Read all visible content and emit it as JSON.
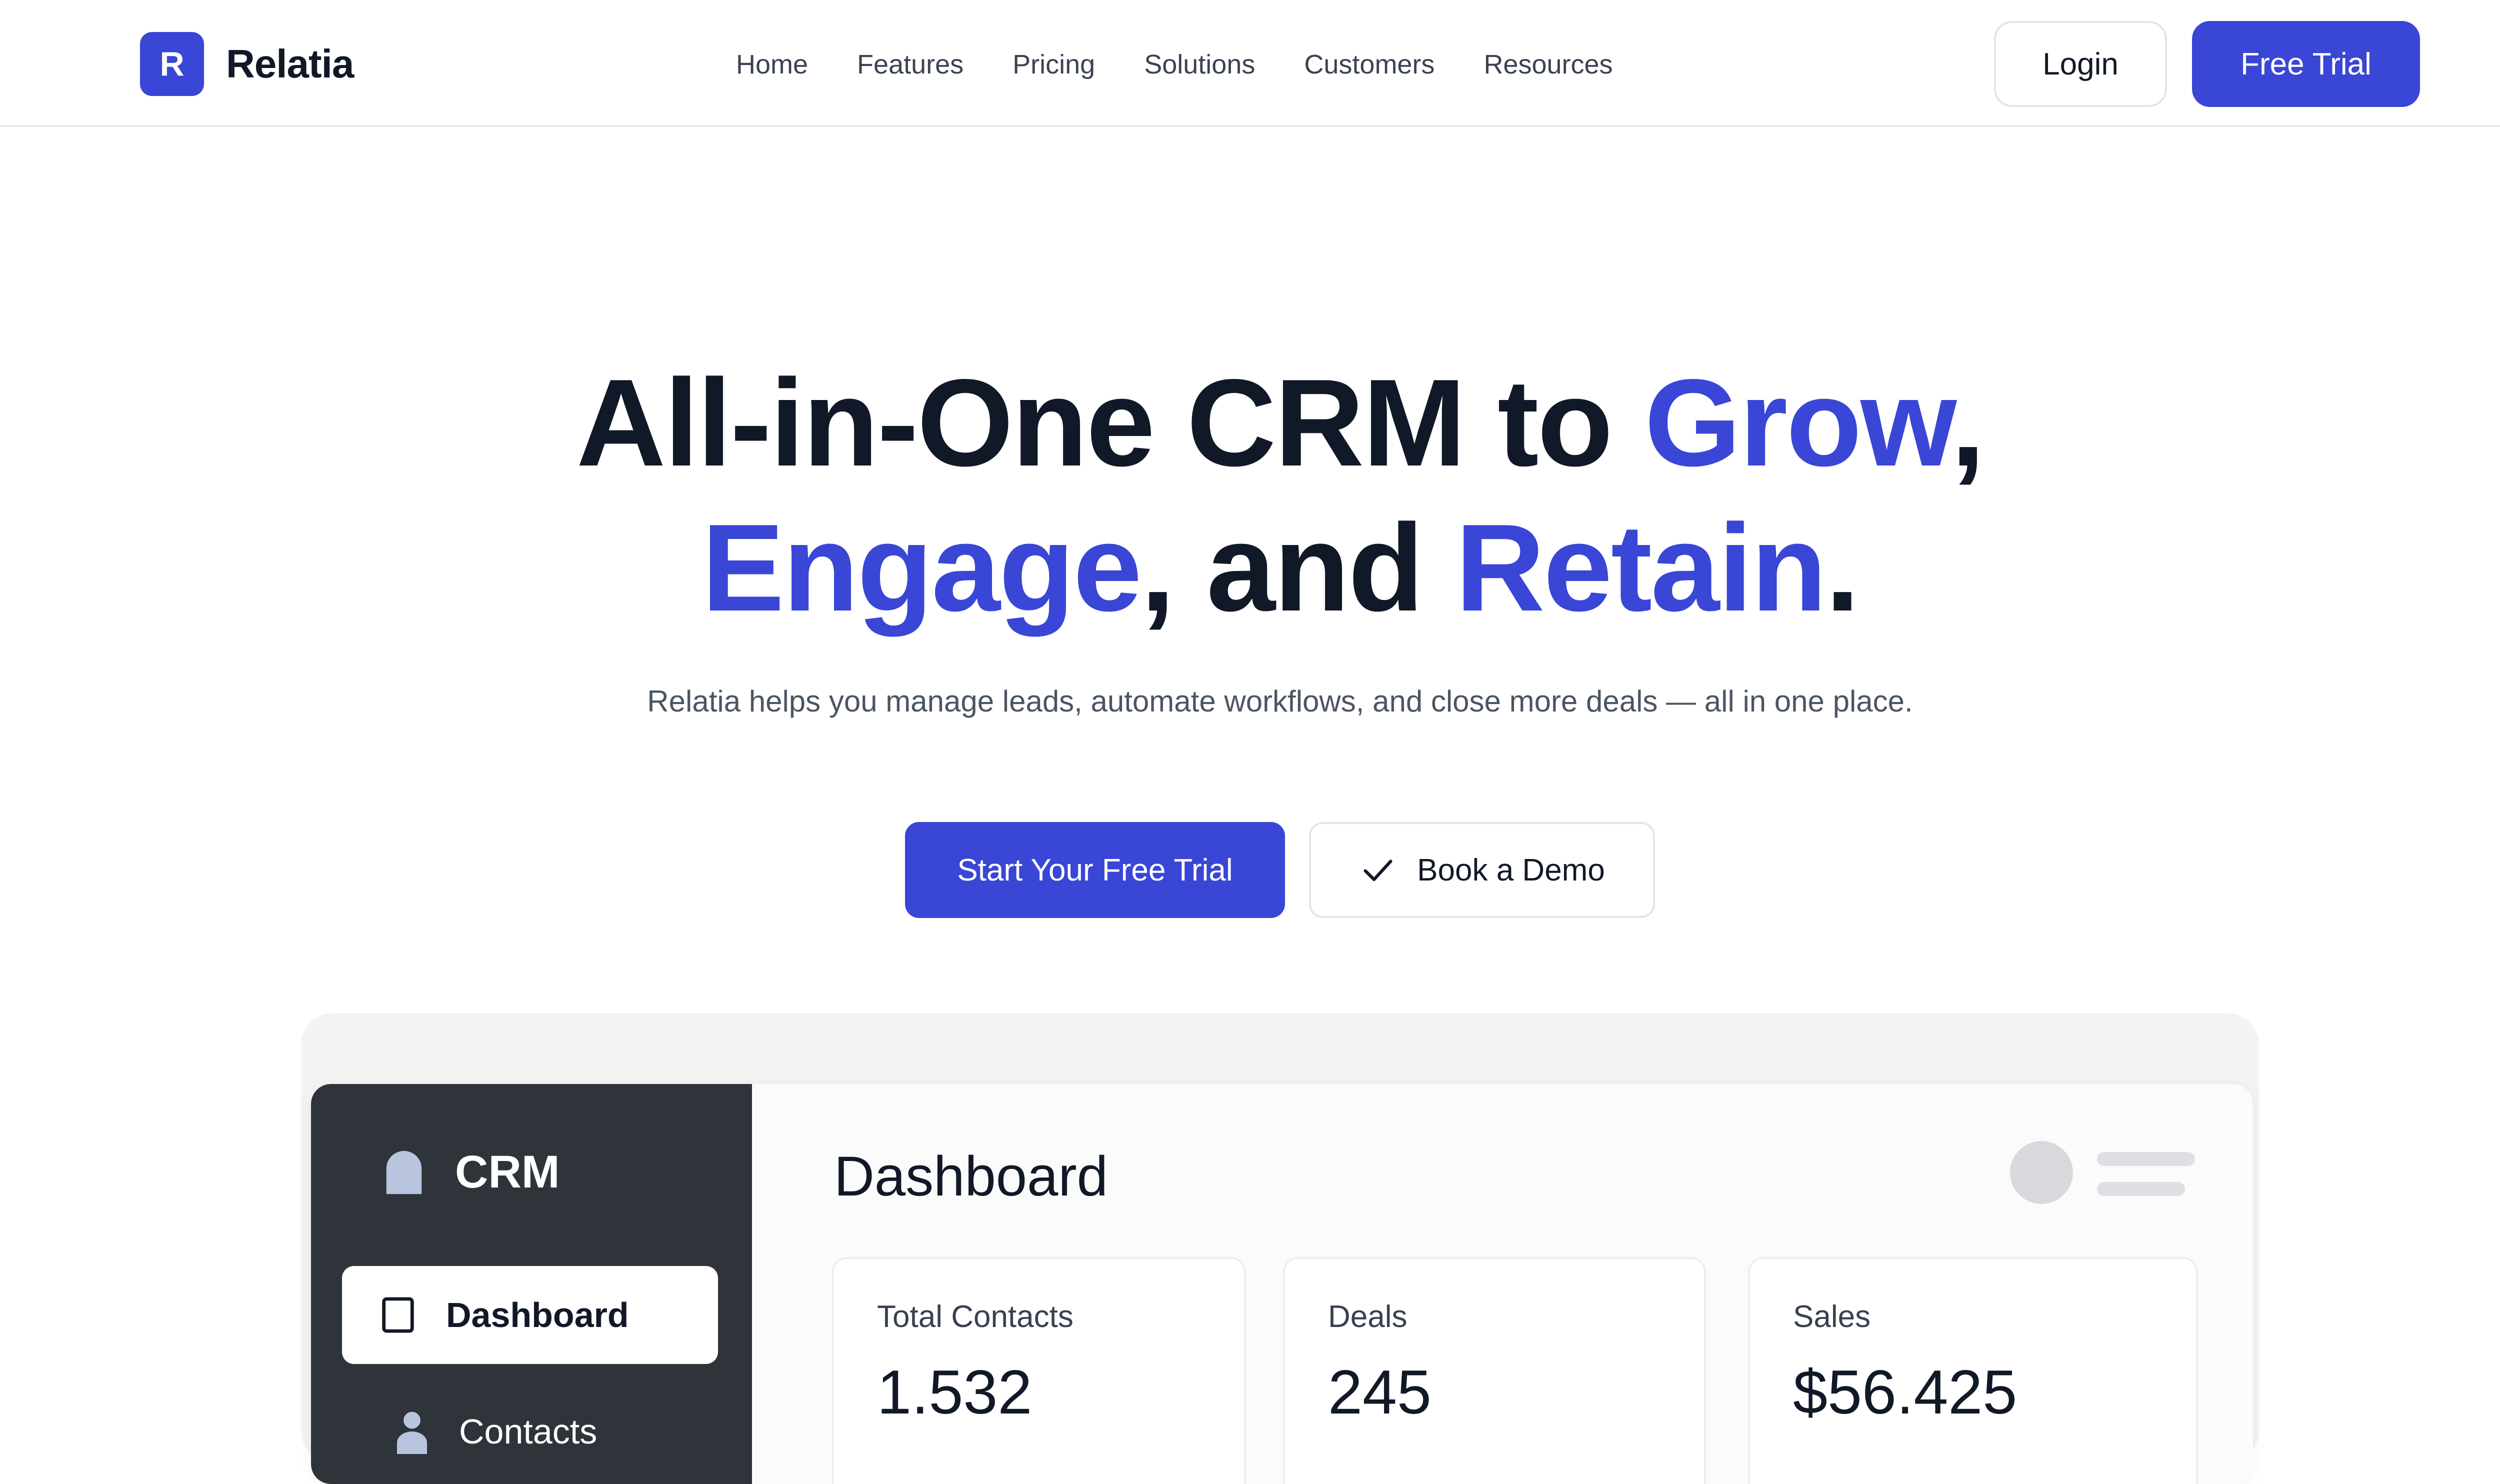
{
  "navbar": {
    "logo_letter": "R",
    "brand": "Relatia",
    "links": [
      "Home",
      "Features",
      "Pricing",
      "Solutions",
      "Customers",
      "Resources"
    ],
    "login_label": "Login",
    "trial_label": "Free Trial"
  },
  "hero": {
    "title_line1_a": "All-in-One CRM to ",
    "title_line1_b": "Grow",
    "title_line1_c": ",",
    "title_line2_a": "Engage",
    "title_line2_b": ", and ",
    "title_line2_c": "Retain",
    "title_line2_d": ".",
    "subtitle": "Relatia helps you manage leads, automate workflows, and close more deals — all in one place.",
    "cta_primary": "Start Your Free Trial",
    "cta_secondary": "Book a Demo"
  },
  "app": {
    "sidebar": {
      "brand": "CRM",
      "items": [
        {
          "label": "Dashboard",
          "icon": "tablet-icon",
          "active": true
        },
        {
          "label": "Contacts",
          "icon": "user-icon",
          "active": false
        }
      ]
    },
    "main": {
      "title": "Dashboard",
      "stats": [
        {
          "label": "Total Contacts",
          "value": "1.532"
        },
        {
          "label": "Deals",
          "value": "245"
        },
        {
          "label": "Sales",
          "value": "$56.425"
        }
      ]
    }
  },
  "colors": {
    "accent": "#3a46d6",
    "sidebar_bg": "#2f343b",
    "text_dark": "#111827"
  }
}
